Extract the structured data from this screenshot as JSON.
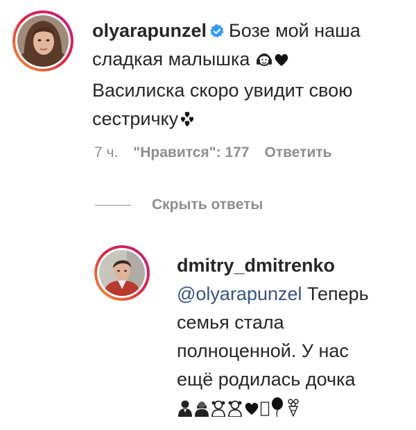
{
  "comment": {
    "username": "olyarapunzel",
    "text_line1": "Бозе мой наша",
    "text_line2": "сладкая малышка",
    "text_line3": "Василиска скоро увидит свою",
    "text_line4": "сестричку",
    "emojis_line2": [
      "baby-with-headphones-emoji",
      "black-heart-emoji"
    ],
    "emoji_line4": "hearts-emoji",
    "time": "7 ч.",
    "likes": "\"Нравится\": 177",
    "reply_label": "Ответить",
    "hide_replies_label": "Скрыть ответы"
  },
  "reply": {
    "username": "dmitry_dmitrenko",
    "mention": "@olyarapunzel",
    "text_line1_rest": "Теперь",
    "text_line2": "семья стала",
    "text_line3": "полноценной. У нас",
    "text_line4": "ещё родилась дочка",
    "emojis_line5": [
      "man-emoji",
      "woman-emoji",
      "girl-emoji",
      "girl-emoji",
      "black-heart-emoji",
      "missing-glyph",
      "balloon-emoji",
      "bouquet-emoji"
    ]
  },
  "colors": {
    "text": "#262626",
    "meta": "#8e8e8e",
    "mention": "#385185",
    "verified": "#3897f0"
  }
}
